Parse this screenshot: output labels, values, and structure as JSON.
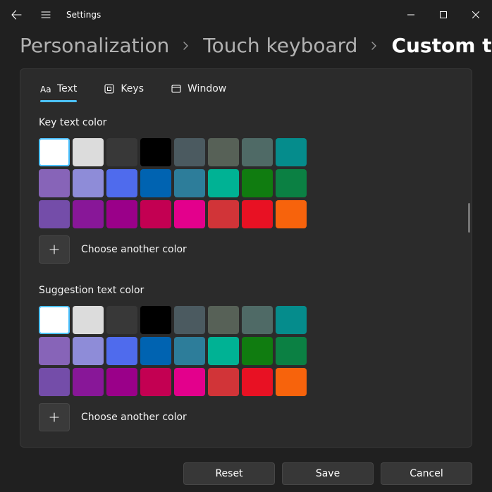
{
  "window": {
    "title": "Settings"
  },
  "breadcrumb": {
    "item0": "Personalization",
    "item1": "Touch keyboard",
    "item2": "Custom theme"
  },
  "tabs": {
    "text": "Text",
    "keys": "Keys",
    "window": "Window"
  },
  "sections": {
    "keyText": {
      "label": "Key text color",
      "choose": "Choose another color"
    },
    "suggestionText": {
      "label": "Suggestion text color",
      "choose": "Choose another color"
    }
  },
  "palette": [
    "#ffffff",
    "#dcdcdc",
    "#383838",
    "#000000",
    "#4b5a60",
    "#576157",
    "#4f6a66",
    "#058c8c",
    "#8764b8",
    "#8e8cd8",
    "#4f6bed",
    "#0063b1",
    "#2d7d9a",
    "#00b294",
    "#107c10",
    "#0b8043",
    "#744da9",
    "#881798",
    "#9a0089",
    "#c30052",
    "#e3008c",
    "#d13438",
    "#e81123",
    "#f7630c"
  ],
  "selectedIndex": 0,
  "footer": {
    "reset": "Reset",
    "save": "Save",
    "cancel": "Cancel"
  }
}
